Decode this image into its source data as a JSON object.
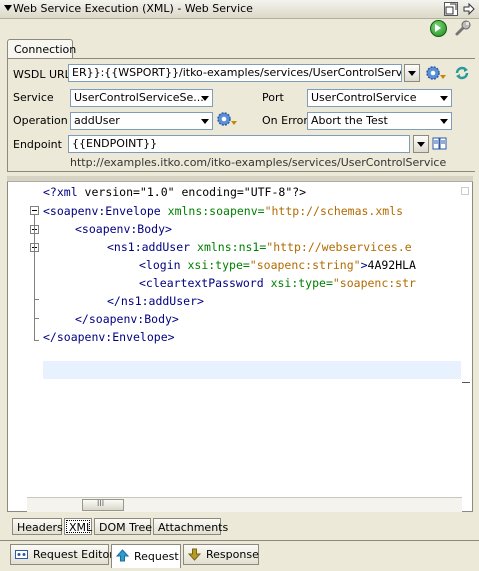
{
  "window": {
    "title": "Web Service Execution (XML) - Web Service"
  },
  "toolbar": {
    "icons": [
      "restore-icon",
      "next-icon",
      "run-icon",
      "wrench-icon"
    ]
  },
  "tabs": {
    "connection": "Connection"
  },
  "form": {
    "wsdl_label": "WSDL URL",
    "wsdl_value": "ER}}:{{WSPORT}}/itko-examples/services/UserControlService?wsdl",
    "service_label": "Service",
    "service_value": "UserControlServiceSe...",
    "port_label": "Port",
    "port_value": "UserControlService",
    "operation_label": "Operation",
    "operation_value": "addUser",
    "onerror_label": "On Error",
    "onerror_value": "Abort the Test",
    "endpoint_label": "Endpoint",
    "endpoint_value": "{{ENDPOINT}}",
    "endpoint_resolved": "http://examples.itko.com/itko-examples/services/UserControlService"
  },
  "editor": {
    "lines": [
      "<?xml version=\"1.0\" encoding=\"UTF-8\"?>",
      "<soapenv:Envelope xmlns:soapenv=\"http://schemas.xmls",
      "<soapenv:Body>",
      "<ns1:addUser xmlns:ns1=\"http://webservices.e",
      "<login xsi:type=\"soapenc:string\">4A92HLA",
      "<cleartextPassword xsi:type=\"soapenc:str",
      "</ns1:addUser>",
      "</soapenv:Body>",
      "</soapenv:Envelope>"
    ],
    "scroll_marker": "III"
  },
  "bottom_tabs": [
    "Headers",
    "XML",
    "DOM Tree",
    "Attachments"
  ],
  "main_tabs": [
    "Request Editor",
    "Request",
    "Response"
  ],
  "colors": {
    "tag": "#000080",
    "attr_name": "#008000",
    "attr_value": "#b36b00",
    "text": "#000000"
  }
}
